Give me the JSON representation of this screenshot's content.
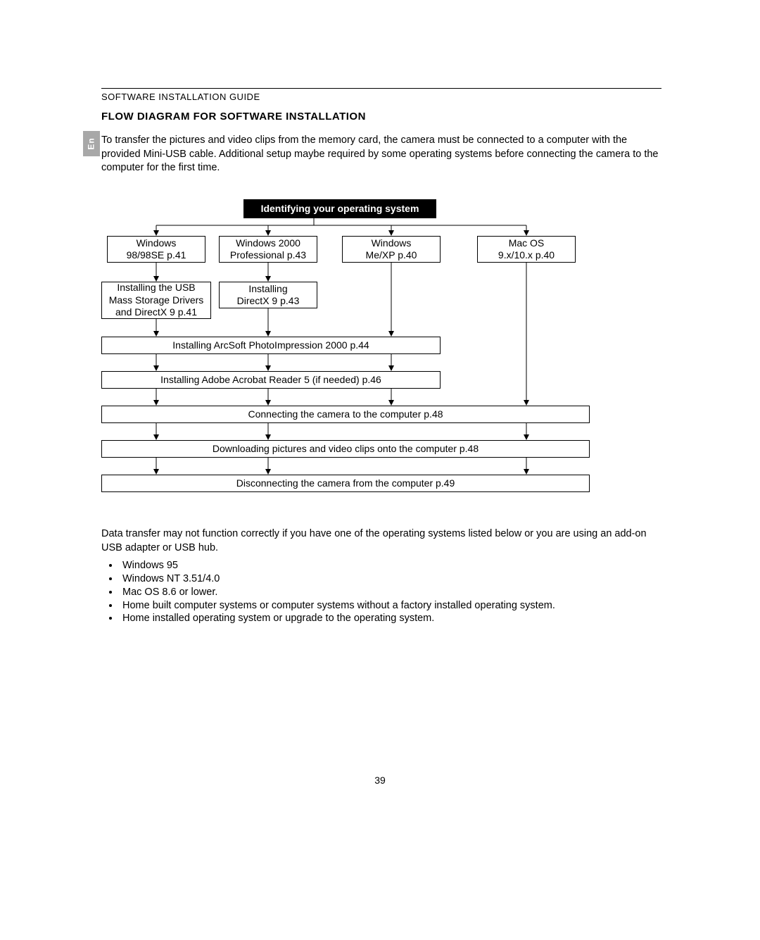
{
  "header": "SOFTWARE INSTALLATION GUIDE",
  "lang_tab": "En",
  "section_title": "FLOW DIAGRAM FOR SOFTWARE INSTALLATION",
  "intro": "To transfer the pictures and video clips from the memory card, the camera must be connected to a computer with the provided Mini-USB cable.  Additional setup maybe required by some operating systems before connecting the camera to the computer for the first time.",
  "flow": {
    "identify": "Identifying your operating system",
    "os": {
      "win98": "Windows\n98/98SE p.41",
      "win2000": "Windows 2000\nProfessional p.43",
      "winme": "Windows\nMe/XP p.40",
      "macos": "Mac OS\n9.x/10.x p.40"
    },
    "install": {
      "usb": "Installing the USB\nMass Storage Drivers\nand DirectX 9 p.41",
      "dx": "Installing\nDirectX 9 p.43"
    },
    "wide": {
      "arcsoft": "Installing ArcSoft PhotoImpression 2000 p.44",
      "acrobat": "Installing Adobe Acrobat Reader 5 (if needed) p.46",
      "connect": "Connecting the camera to the computer p.48",
      "download": "Downloading pictures and video clips onto the computer p.48",
      "disconnect": "Disconnecting the camera from the computer p.49"
    }
  },
  "notice": "Data transfer may not function correctly if you have one of the operating systems listed below or you are using an add-on USB adapter or USB hub.",
  "unsupported": [
    "Windows 95",
    "Windows NT 3.51/4.0",
    "Mac OS 8.6 or lower.",
    "Home built computer systems or computer systems without a factory installed operating system.",
    "Home installed operating system or upgrade to the operating system."
  ],
  "page_number": "39"
}
